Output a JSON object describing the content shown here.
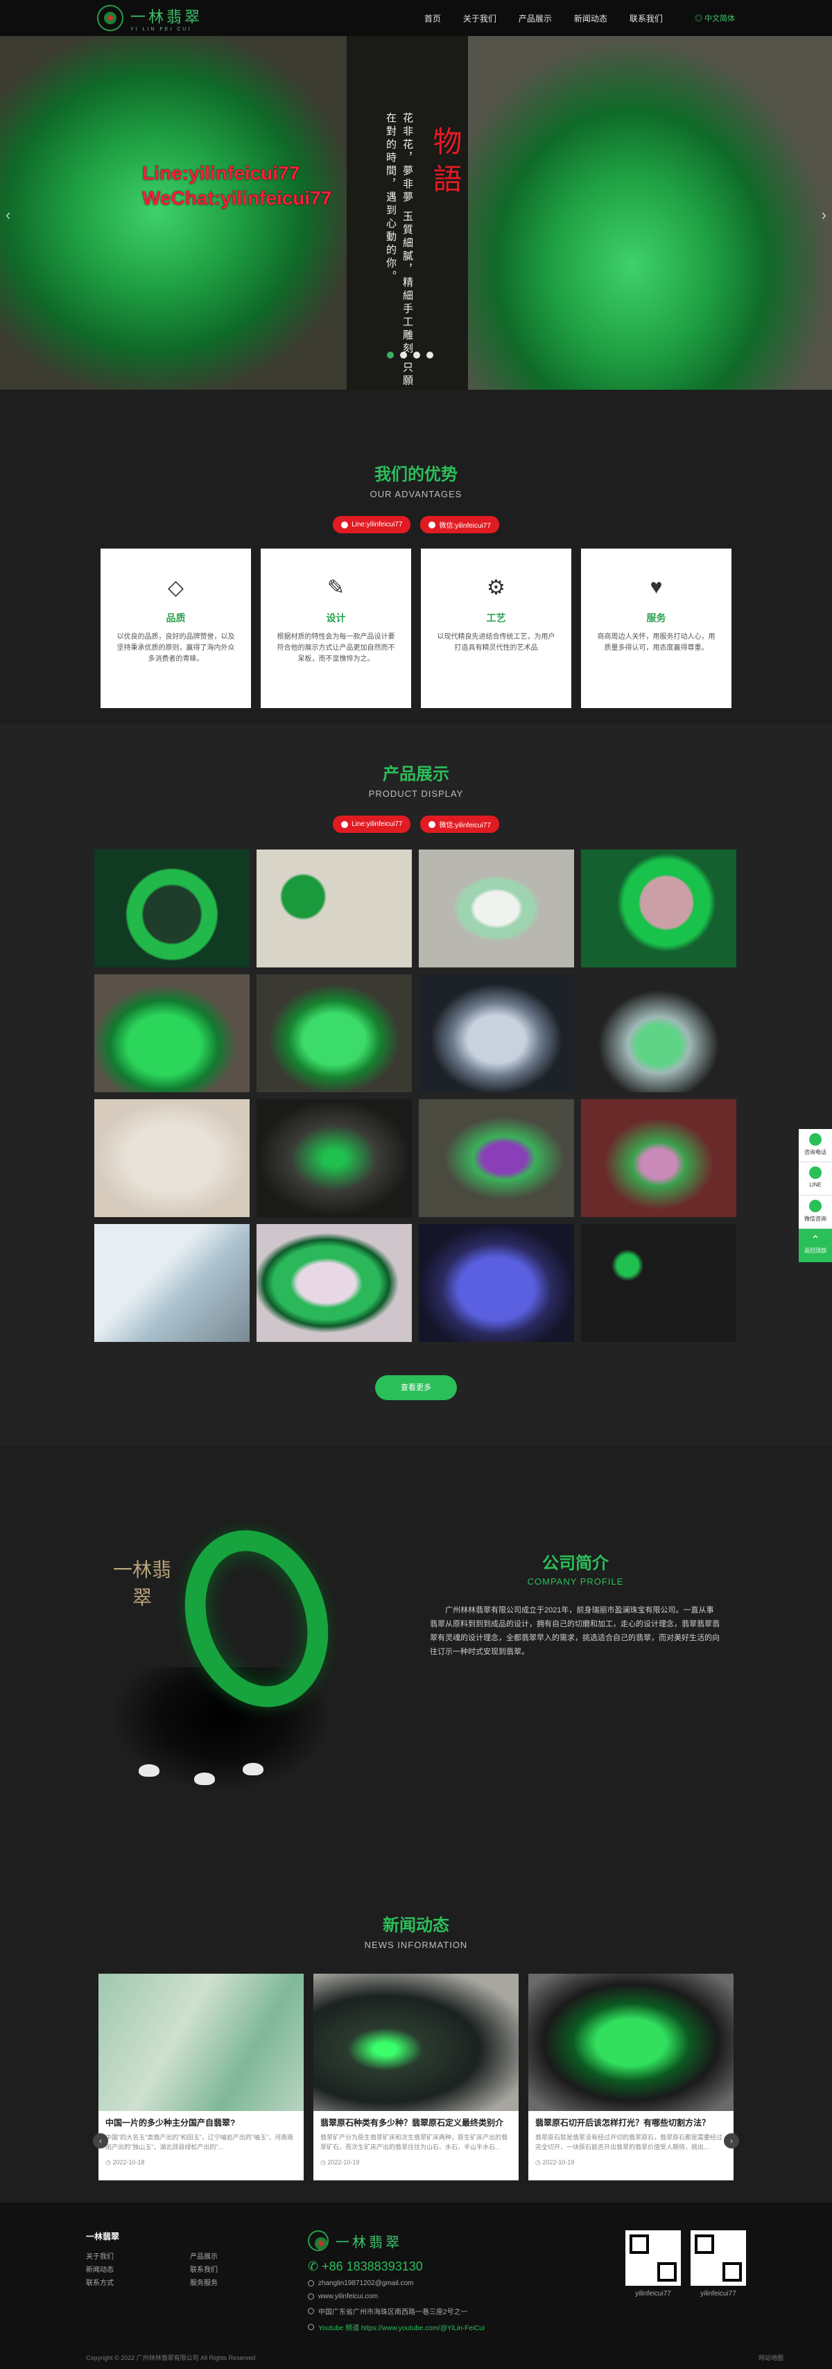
{
  "header": {
    "brand_cn": "一林翡翠",
    "brand_en": "YI LIN FEI CUI",
    "nav": [
      "首页",
      "关于我们",
      "产品展示",
      "新闻动态",
      "联系我们"
    ],
    "lang": "中文简体"
  },
  "hero": {
    "watermark_line1": "Line:yilinfeicui77",
    "watermark_line2": "WeChat:yilinfeicui77",
    "poem": "花非花，夢非夢 玉質細膩，精細手工雕刻 只願在對的時間，遇到心動的你。",
    "title": "物語",
    "prev": "‹",
    "next": "›"
  },
  "tags": {
    "line": "Line:yilinfeicui77",
    "wechat": "微信:yilinfeicui77"
  },
  "advantages": {
    "title_cn": "我们的优势",
    "title_en": "OUR ADVANTAGES",
    "cards": [
      {
        "title": "品质",
        "desc": "以优良的品质，良好的品牌赞誉，以及坚持秉承优质的原则，赢得了海内外众多消费者的青睐。"
      },
      {
        "title": "设计",
        "desc": "根据材质的特性会为每一款产品设计要符合他的展示方式让产品更加自然而不呆板，而不显憔悴为之。"
      },
      {
        "title": "工艺",
        "desc": "以现代精良先进结合传统工艺，为用户打造具有精灵代性的艺术品"
      },
      {
        "title": "服务",
        "desc": "商商周边人关怀，用服务打动人心，用质量多得认可，用态度赢得尊重。"
      }
    ]
  },
  "products": {
    "title_cn": "产品展示",
    "title_en": "PRODUCT DISPLAY",
    "more": "查看更多"
  },
  "company": {
    "title_cn": "公司简介",
    "title_en": "COMPANY PROFILE",
    "seal": "一林翡翠",
    "text": "广州林林翡翠有限公司成立于2021年，前身瑞丽市盈澜珠宝有限公司。一直从事翡翠从原料到到到成品的设计，拥有自己的切磨和加工，走心的设计理念，翡翠翡翠翡翠有灵魂的设计理念，全都翡翠早入的需求，挑选适合自己的翡翠，而对美好生活的向往订示一种时式安现到翡翠。"
  },
  "news": {
    "title_cn": "新闻动态",
    "title_en": "NEWS INFORMATION",
    "items": [
      {
        "title": "中国一片的多少种主分国产自翡翠?",
        "summary": "中国\"四大名玉\"类翡产出的\"和田玉\"，辽宁岫岩产出的\"岫玉\"，河南南阳产出的\"独山玉\"，湖北郧县绿松产出的\"...",
        "date": "2022-10-18"
      },
      {
        "title": "翡翠原石种类有多少种？翡翠原石定义最终类别介",
        "summary": "翡翠矿产分为原生翡翠矿床和次生翡翠矿床两种，原生矿床产出的翡翠矿石，而次生矿床产出的翡翠往往为山石、水石、半山半水石...",
        "date": "2022-10-19"
      },
      {
        "title": "翡翠原石切开后该怎样打光？有哪些切割方法？",
        "summary": "翡翠原石就是翡翠没有经过开切的翡翠原石，翡翠原石都是需要经过完全切开，一块原石能否开出翡翠的翡翠价值受人期待，挑出...",
        "date": "2022-10-19"
      }
    ]
  },
  "footer": {
    "heading": "一林翡翠",
    "links": [
      "关于我们",
      "产品展示",
      "新闻动态",
      "联系我们",
      "联系方式",
      "服务服务"
    ],
    "brand_cn": "一林翡翠",
    "phone": "+86 18388393130",
    "email": "zhanglin19871202@gmail.com",
    "website": "www.yilinfeicui.com",
    "address": "中国广东省广州市海珠区南西路一巷三座2号之一",
    "youtube": "Youtube 频道 https://www.youtube.com/@YiLin-FeiCui",
    "qr1_label": "yilinfeicui77",
    "qr2_label": "yilinfeicui77",
    "copyright": "Copyright © 2022 广州林林翡翠有限公司 All Rights Reserved",
    "right_text": "网站地图"
  },
  "sidebar": {
    "items": [
      "咨询电话",
      "LINE",
      "微信咨询"
    ],
    "top": "返回顶部"
  },
  "colors": {
    "accent_green": "#2bbf5a",
    "tag_red": "#e01b22",
    "background": "#1e1e1e"
  }
}
